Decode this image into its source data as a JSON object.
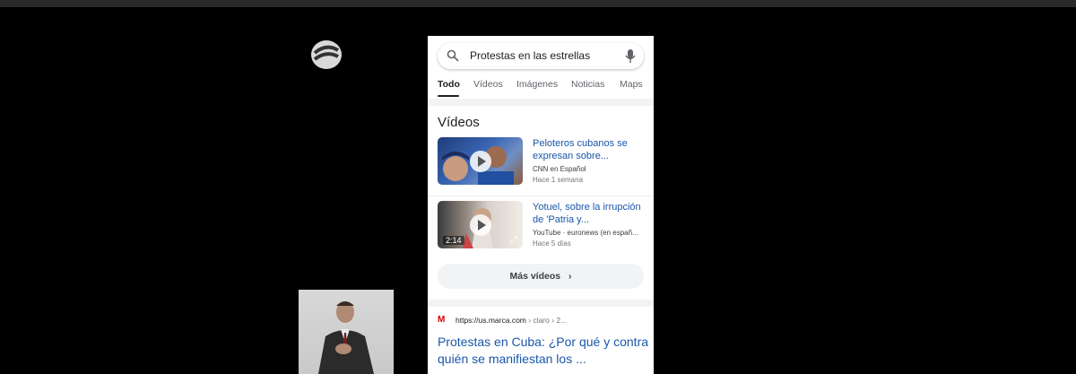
{
  "search": {
    "query": "Protestas en las estrellas"
  },
  "tabs": [
    "Todo",
    "Vídeos",
    "Imágenes",
    "Noticias",
    "Maps"
  ],
  "videos": {
    "title": "Vídeos",
    "items": [
      {
        "title": "Peloteros cubanos se expresan sobre...",
        "source": "CNN en Español",
        "time": "Hace 1 semana",
        "duration": ""
      },
      {
        "title": "Yotuel, sobre la irrupción de 'Patria y...",
        "source": "YouTube · euronews (en españ...",
        "time": "Hace 5 días",
        "duration": "2:14"
      }
    ],
    "more_label": "Más vídeos"
  },
  "result": {
    "url": "https://us.marca.com",
    "url_path": " › claro › 2...",
    "title": "Protestas en Cuba: ¿Por qué y contra quién se manifiestan los ..."
  },
  "icons": {
    "search": "search-icon",
    "mic": "mic-icon",
    "chevron": "chevron-right-icon",
    "play": "play-icon",
    "expand": "expand-icon",
    "favicon": "marca-favicon-icon",
    "logo": "channel-logo-icon"
  }
}
